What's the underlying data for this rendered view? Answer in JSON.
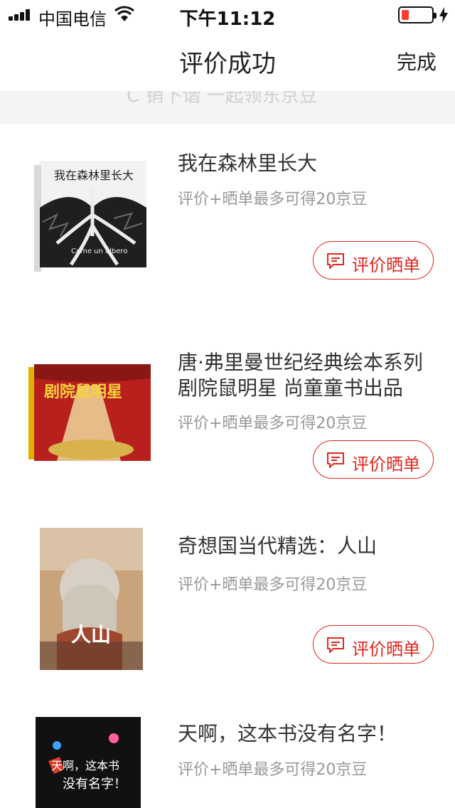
{
  "status_bar": {
    "carrier": "中国电信",
    "time": "下午11:12"
  },
  "nav": {
    "title": "评价成功",
    "done_label": "完成"
  },
  "banner": {
    "partial_text": "C 销下谐 一起领东京豆 "
  },
  "colors": {
    "accent": "#e1251b",
    "hint_text": "#999999",
    "band_bg": "#f4f4f4"
  },
  "products": [
    {
      "title": "我在森林里长大",
      "hint": "评价+晒单最多可得20京豆",
      "button": "评价晒单",
      "cover_title": "我在森林里长大",
      "cover_subtitle": "Come un albero"
    },
    {
      "title": "唐·弗里曼世纪经典绘本系列剧院鼠明星 尚童童书出品",
      "hint": "评价+晒单最多可得20京豆",
      "button": "评价晒单",
      "cover_title": "剧院鼠明星"
    },
    {
      "title": "奇想国当代精选：人山",
      "hint": "评价+晒单最多可得20京豆",
      "button": "评价晒单",
      "cover_title": "人山"
    },
    {
      "title": "天啊，这本书没有名字！",
      "hint": "评价+晒单最多可得20京豆",
      "cover_title": "天啊，这本书 没有名字！"
    }
  ]
}
